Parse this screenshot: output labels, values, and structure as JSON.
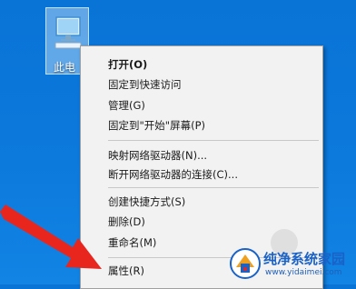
{
  "desktop": {
    "icon_label": "此电",
    "icon_name": "computer-icon"
  },
  "context_menu": {
    "items": [
      {
        "label": "打开(O)",
        "bold": true
      },
      {
        "label": "固定到快速访问"
      },
      {
        "label": "管理(G)"
      },
      {
        "label": "固定到\"开始\"屏幕(P)"
      },
      {
        "label": "映射网络驱动器(N)..."
      },
      {
        "label": "断开网络驱动器的连接(C)..."
      },
      {
        "label": "创建快捷方式(S)"
      },
      {
        "label": "删除(D)"
      },
      {
        "label": "重命名(M)"
      },
      {
        "label": "属性(R)"
      }
    ]
  },
  "watermark": {
    "title": "纯净系统家园",
    "url": "www.yidaimei.com"
  },
  "colors": {
    "desktop_blue": "#0c79dc",
    "menu_bg": "#f2f2f2",
    "arrow_red": "#e8261e"
  }
}
